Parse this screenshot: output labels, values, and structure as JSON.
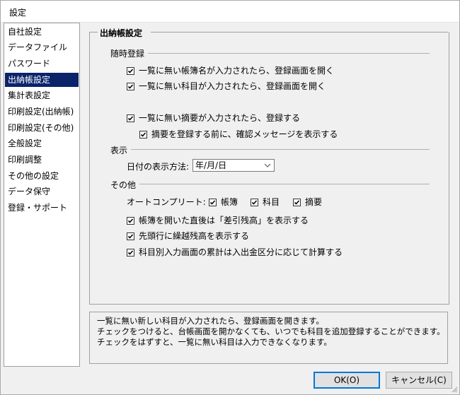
{
  "window": {
    "title": "設定"
  },
  "sidebar": {
    "items": [
      {
        "label": "自社設定",
        "selected": false
      },
      {
        "label": "データファイル",
        "selected": false
      },
      {
        "label": "パスワード",
        "selected": false
      },
      {
        "label": "出納帳設定",
        "selected": true
      },
      {
        "label": "集計表設定",
        "selected": false
      },
      {
        "label": "印刷設定(出納帳)",
        "selected": false
      },
      {
        "label": "印刷設定(その他)",
        "selected": false
      },
      {
        "label": "全般設定",
        "selected": false
      },
      {
        "label": "印刷調整",
        "selected": false
      },
      {
        "label": "その他の設定",
        "selected": false
      },
      {
        "label": "データ保守",
        "selected": false
      },
      {
        "label": "登録・サポート",
        "selected": false
      }
    ]
  },
  "panel": {
    "title": "出納帳設定",
    "section_register": "随時登録",
    "cb_account_book": "一覧に無い帳簿名が入力されたら、登録画面を開く",
    "cb_subject": "一覧に無い科目が入力されたら、登録画面を開く",
    "cb_summary": "一覧に無い摘要が入力されたら、登録する",
    "cb_summary_confirm": "摘要を登録する前に、確認メッセージを表示する",
    "section_display": "表示",
    "date_format_label": "日付の表示方法:",
    "date_format_value": "年/月/日",
    "section_other": "その他",
    "autocomplete_label": "オートコンプリート:",
    "ac_book": "帳簿",
    "ac_subject": "科目",
    "ac_summary": "摘要",
    "cb_balance_diff": "帳簿を開いた直後は「差引残高」を表示する",
    "cb_carry_over": "先頭行に繰越残高を表示する",
    "cb_cumulative": "科目別入力画面の累計は入出金区分に応じて計算する"
  },
  "description": {
    "line1": "一覧に無い新しい科目が入力されたら、登録画面を開きます。",
    "line2": "チェックをつけると、台帳画面を開かなくても、いつでも科目を追加登録することができます。",
    "line3": "チェックをはずすと、一覧に無い科目は入力できなくなります。"
  },
  "buttons": {
    "ok": "OK(O)",
    "cancel": "キャンセル(C)"
  },
  "colors": {
    "selection": "#0a246a",
    "accent": "#0078d7"
  },
  "icons": {
    "checkbox": "check-mark",
    "combo": "chevron-down-icon"
  }
}
